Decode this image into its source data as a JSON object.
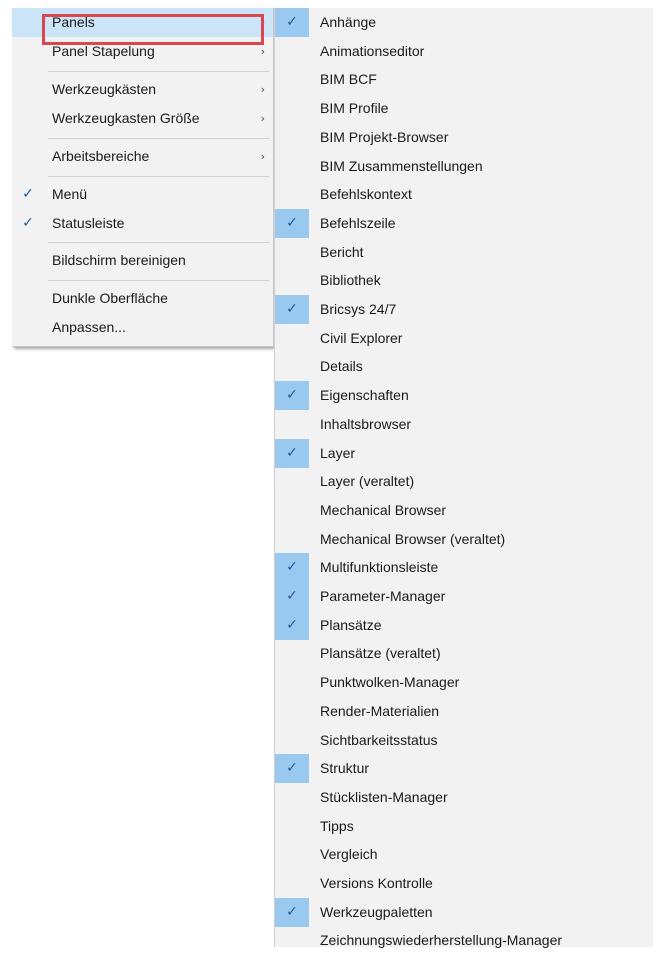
{
  "main_menu": {
    "items": [
      {
        "label": "Panels",
        "has_submenu": true
      },
      {
        "label": "Panel Stapelung",
        "has_submenu": true
      },
      {
        "label": "Werkzeugkästen",
        "has_submenu": true
      },
      {
        "label": "Werkzeugkasten Größe",
        "has_submenu": true
      },
      {
        "label": "Arbeitsbereiche",
        "has_submenu": true
      },
      {
        "label": "Menü",
        "checked": true
      },
      {
        "label": "Statusleiste",
        "checked": true
      },
      {
        "label": "Bildschirm bereinigen"
      },
      {
        "label": "Dunkle Oberfläche"
      },
      {
        "label": "Anpassen..."
      }
    ]
  },
  "panels_submenu": {
    "items": [
      {
        "label": "Anhänge",
        "checked": true
      },
      {
        "label": "Animationseditor",
        "checked": false
      },
      {
        "label": "BIM BCF",
        "checked": false
      },
      {
        "label": "BIM Profile",
        "checked": false
      },
      {
        "label": "BIM Projekt-Browser",
        "checked": false
      },
      {
        "label": "BIM Zusammenstellungen",
        "checked": false
      },
      {
        "label": "Befehlskontext",
        "checked": false
      },
      {
        "label": "Befehlszeile",
        "checked": true
      },
      {
        "label": "Bericht",
        "checked": false
      },
      {
        "label": "Bibliothek",
        "checked": false
      },
      {
        "label": "Bricsys 24/7",
        "checked": true
      },
      {
        "label": "Civil Explorer",
        "checked": false
      },
      {
        "label": "Details",
        "checked": false
      },
      {
        "label": "Eigenschaften",
        "checked": true
      },
      {
        "label": "Inhaltsbrowser",
        "checked": false
      },
      {
        "label": "Layer",
        "checked": true
      },
      {
        "label": "Layer  (veraltet)",
        "checked": false
      },
      {
        "label": "Mechanical Browser",
        "checked": false
      },
      {
        "label": "Mechanical Browser (veraltet)",
        "checked": false
      },
      {
        "label": "Multifunktionsleiste",
        "checked": true
      },
      {
        "label": "Parameter-Manager",
        "checked": true
      },
      {
        "label": "Plansätze",
        "checked": true
      },
      {
        "label": "Plansätze (veraltet)",
        "checked": false
      },
      {
        "label": "Punktwolken-Manager",
        "checked": false
      },
      {
        "label": "Render-Materialien",
        "checked": false
      },
      {
        "label": "Sichtbarkeitsstatus",
        "checked": false
      },
      {
        "label": "Struktur",
        "checked": true
      },
      {
        "label": "Stücklisten-Manager",
        "checked": false
      },
      {
        "label": "Tipps",
        "checked": false
      },
      {
        "label": "Vergleich",
        "checked": false
      },
      {
        "label": "Versions Kontrolle",
        "checked": false
      },
      {
        "label": "Werkzeugpaletten",
        "checked": true
      },
      {
        "label": "Zeichnungswiederherstellung-Manager",
        "checked": false
      }
    ]
  },
  "symbols": {
    "check": "✓",
    "submenu_arrow": "›"
  },
  "colors": {
    "menu_background": "#f2f2f2",
    "hover_row": "#cce4f7",
    "checked_gutter": "#99c9ef",
    "highlight_box": "#d9484f"
  }
}
